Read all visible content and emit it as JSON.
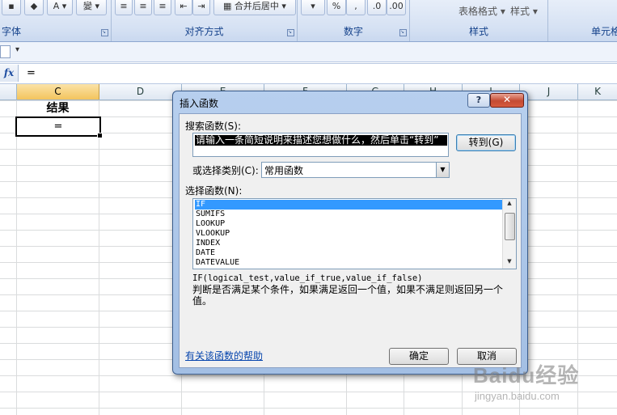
{
  "ribbon": {
    "groups": {
      "font": "字体",
      "alignment": "对齐方式",
      "number": "数字",
      "styles": "样式",
      "cells": "单元格"
    },
    "merge_center": "合并后居中",
    "percent": "%",
    "table_format": "表格格式",
    "cell_style": "样式",
    "wrap_glyph": "變",
    "font_color_glyph": "A"
  },
  "formula_bar": {
    "fx_label": "fx",
    "value": "="
  },
  "sheet": {
    "columns": [
      "C",
      "D",
      "E",
      "F",
      "G",
      "H",
      "I",
      "J",
      "K"
    ],
    "selected_column": "C",
    "c1": "结果",
    "c2": "="
  },
  "dialog": {
    "title": "插入函数",
    "help_btn": "?",
    "close_btn": "✕",
    "search_label": "搜索函数(S):",
    "search_value": "请输入一条简短说明来描述您想做什么，然后单击“转到”",
    "goto_btn": "转到(G)",
    "category_label": "或选择类别(C):",
    "category_value": "常用函数",
    "select_label": "选择函数(N):",
    "functions": [
      "IF",
      "SUMIFS",
      "LOOKUP",
      "VLOOKUP",
      "INDEX",
      "DATE",
      "DATEVALUE"
    ],
    "selected_function": "IF",
    "signature": "IF(logical_test,value_if_true,value_if_false)",
    "description": "判断是否满足某个条件，如果满足返回一个值，如果不满足则返回另一个值。",
    "help_link": "有关该函数的帮助",
    "ok_btn": "确定",
    "cancel_btn": "取消"
  },
  "watermark": {
    "main": "Baidu经验",
    "sub": "jingyan.baidu.com"
  }
}
